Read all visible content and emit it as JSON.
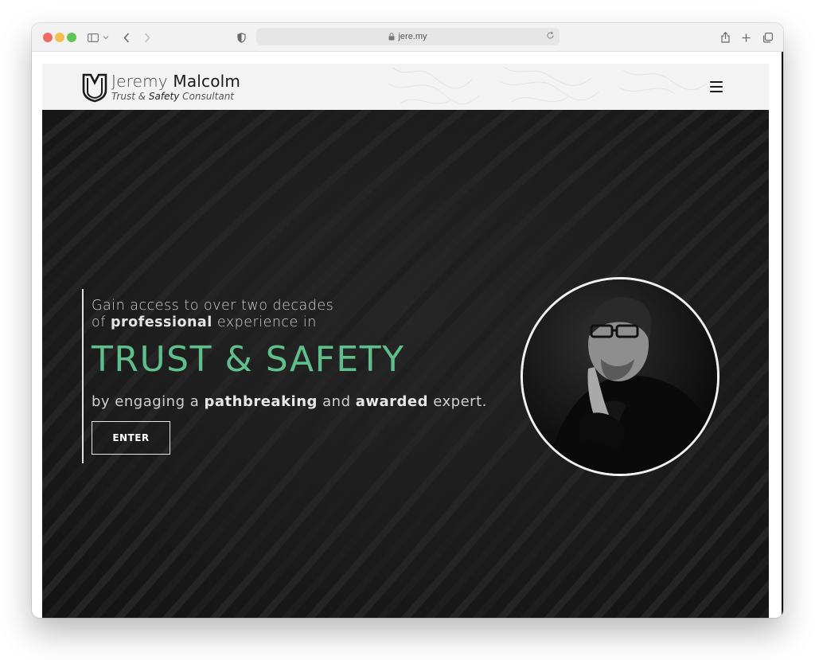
{
  "browser": {
    "url": "jere.my",
    "icons": [
      "sidebar-icon",
      "chevron-down-icon",
      "back-icon",
      "forward-icon",
      "shield-icon",
      "lock-icon",
      "reload-icon",
      "share-icon",
      "plus-icon",
      "tabs-icon"
    ]
  },
  "site": {
    "logo": {
      "first_name": "Jeremy",
      "last_name": "Malcolm",
      "tagline_a": "Trust &",
      "tagline_b": "Safety",
      "tagline_c": "Consultant"
    },
    "menu_icon": "hamburger-icon"
  },
  "hero": {
    "intro_line1": "Gain access to over two decades",
    "intro_line2_pre": "of",
    "intro_line2_bold": "professional",
    "intro_line2_post": "experience in",
    "headline": "TRUST & SAFETY",
    "outro_pre": "by engaging a",
    "outro_bold1": "pathbreaking",
    "outro_mid": "and",
    "outro_bold2": "awarded",
    "outro_post": "expert.",
    "cta_label": "ENTER"
  },
  "colors": {
    "accent": "#5fbf8a",
    "hero_bg": "#1b1b1b",
    "header_bg": "#f3f3f3"
  }
}
